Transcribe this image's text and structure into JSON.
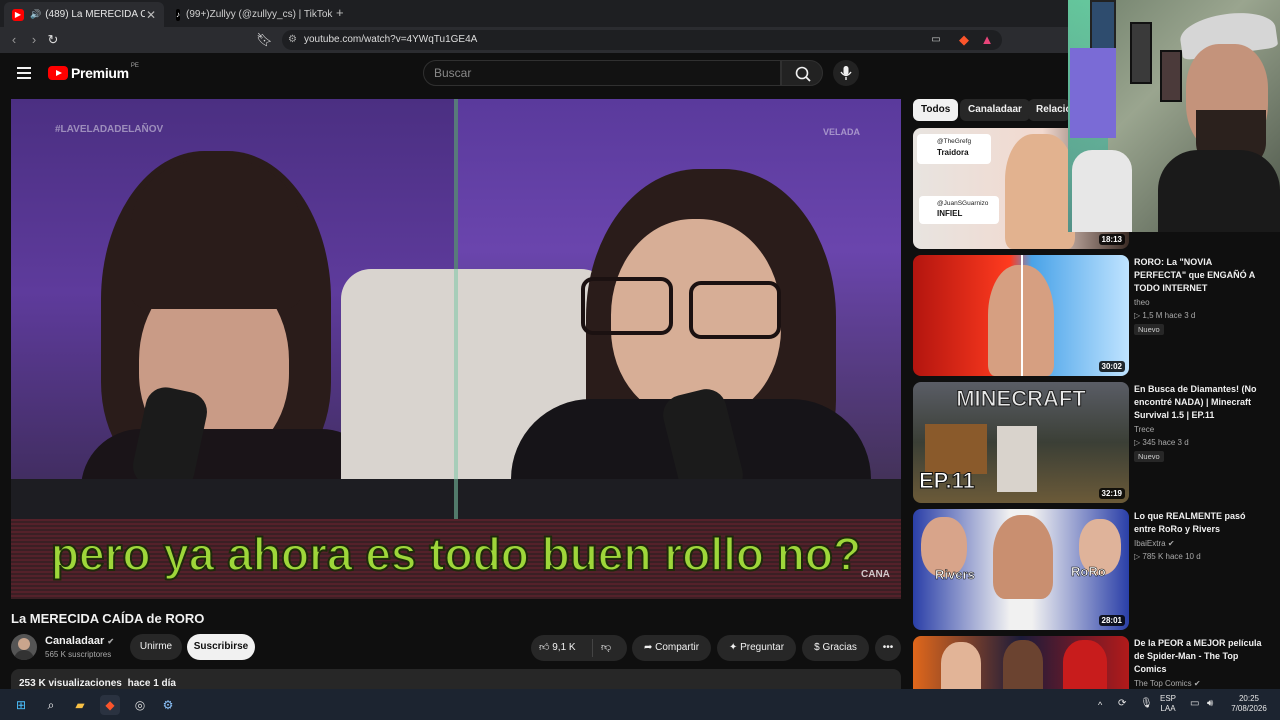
{
  "browser": {
    "tabs": [
      {
        "label": "(489) La MERECIDA CAÍDA de",
        "active": true,
        "icon": "youtube-icon"
      },
      {
        "label": "(99+)Zullyy (@zullyy_cs) | TikTok",
        "active": false,
        "icon": "tiktok-icon"
      }
    ],
    "new_tab": "+",
    "url": "youtube.com/watch?v=4YWqTu1GE4A"
  },
  "youtube": {
    "logo_word": "Premium",
    "logo_region": "PE",
    "search_placeholder": "Buscar"
  },
  "video": {
    "subtitle": "pero ya ahora es todo buen rollo no?",
    "watermark_left": "#LAVELADADELAÑOV",
    "watermark_right": "VELADA",
    "watermark_corner": "CANA"
  },
  "details": {
    "title": "La MERECIDA CAÍDA de RORO",
    "channel": "Canaladaar",
    "subscribers": "565 K suscriptores",
    "join_label": "Unirme",
    "subscribe_label": "Suscribirse",
    "like_count": "9,1 K",
    "share_label": "Compartir",
    "ask_label": "Preguntar",
    "thanks_label": "Gracias",
    "views": "253 K visualizaciones",
    "published": "hace 1 día"
  },
  "chips": [
    "Todos",
    "Canaladaar",
    "Relacio"
  ],
  "recommendations": [
    {
      "duration": "18:13",
      "thumb_text_1": "@TheGrefg",
      "thumb_text_2": "Traidora",
      "thumb_text_3": "@JuanSGuarnizo",
      "thumb_text_4": "INFIEL"
    },
    {
      "title": "RORO: La \"NOVIA PERFECTA\" que ENGAÑÓ A TODO INTERNET",
      "channel": "theo",
      "views": "1,5 M",
      "age": "hace 3 d",
      "badge": "Nuevo",
      "duration": "30:02"
    },
    {
      "title": "En Busca de Diamantes! (No encontré NADA) | Minecraft Survival 1.5 | EP.11",
      "channel": "Trece",
      "views": "345",
      "age": "hace 3 d",
      "badge": "Nuevo",
      "duration": "32:19",
      "thumb_text_1": "MINECRAFT",
      "thumb_text_2": "EP.11"
    },
    {
      "title": "Lo que REALMENTE pasó entre RoRo y Rivers",
      "channel": "IbaiExtra",
      "views": "785 K",
      "age": "hace 10 d",
      "duration": "28:01",
      "thumb_text_1": "Rivers",
      "thumb_text_2": "RoRo"
    },
    {
      "title": "De la PEOR a MEJOR película de Spider-Man - The Top Comics",
      "channel": "The Top Comics"
    }
  ],
  "taskbar": {
    "lang_1": "ESP",
    "lang_2": "LAA",
    "time": "20:25",
    "date": "7/08/2026"
  },
  "colors": {
    "youtube_red": "#ff0000",
    "subtitle_green": "#9ed63a",
    "background": "#0f0f0f"
  }
}
